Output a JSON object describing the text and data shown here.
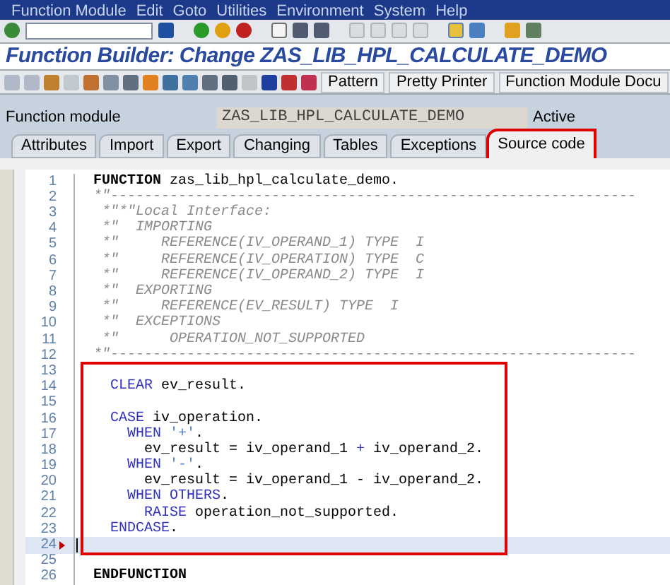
{
  "menu_bar": [
    "Function Module",
    "Edit",
    "Goto",
    "Utilities",
    "Environment",
    "System",
    "Help"
  ],
  "title": "Function Builder: Change ZAS_LIB_HPL_CALCULATE_DEMO",
  "app_toolbar": {
    "buttons": [
      "Pattern",
      "Pretty Printer",
      "Function Module Docu"
    ]
  },
  "header": {
    "label": "Function module",
    "value": "ZAS_LIB_HPL_CALCULATE_DEMO",
    "status": "Active"
  },
  "tabs": [
    {
      "label": "Attributes",
      "selected": false,
      "highlighted": false
    },
    {
      "label": "Import",
      "selected": false,
      "highlighted": false
    },
    {
      "label": "Export",
      "selected": false,
      "highlighted": false
    },
    {
      "label": "Changing",
      "selected": false,
      "highlighted": false
    },
    {
      "label": "Tables",
      "selected": false,
      "highlighted": false
    },
    {
      "label": "Exceptions",
      "selected": false,
      "highlighted": false
    },
    {
      "label": "Source code",
      "selected": true,
      "highlighted": true
    }
  ],
  "editor": {
    "lines_before": [
      {
        "number": "1",
        "current": false,
        "segments": [
          {
            "kind": "bold",
            "text": "FUNCTION"
          },
          {
            "kind": "plain",
            "text": " zas_lib_hpl_calculate_demo."
          }
        ]
      },
      {
        "number": "2",
        "current": false,
        "segments": [
          {
            "kind": "comment",
            "text": "*\"--------------------------------------------------------------"
          }
        ]
      },
      {
        "number": "3",
        "current": false,
        "segments": [
          {
            "kind": "comment",
            "text": " *\"*\"Local Interface:"
          }
        ]
      },
      {
        "number": "4",
        "current": false,
        "segments": [
          {
            "kind": "comment",
            "text": " *\"  IMPORTING"
          }
        ]
      },
      {
        "number": "5",
        "current": false,
        "segments": [
          {
            "kind": "comment",
            "text": " *\"     REFERENCE(IV_OPERAND_1) TYPE  I"
          }
        ]
      },
      {
        "number": "6",
        "current": false,
        "segments": [
          {
            "kind": "comment",
            "text": " *\"     REFERENCE(IV_OPERATION) TYPE  C"
          }
        ]
      },
      {
        "number": "7",
        "current": false,
        "segments": [
          {
            "kind": "comment",
            "text": " *\"     REFERENCE(IV_OPERAND_2) TYPE  I"
          }
        ]
      },
      {
        "number": "8",
        "current": false,
        "segments": [
          {
            "kind": "comment",
            "text": " *\"  EXPORTING"
          }
        ]
      },
      {
        "number": "9",
        "current": false,
        "segments": [
          {
            "kind": "comment",
            "text": " *\"     REFERENCE(EV_RESULT) TYPE  I"
          }
        ]
      },
      {
        "number": "10",
        "current": false,
        "segments": [
          {
            "kind": "comment",
            "text": " *\"  EXCEPTIONS"
          }
        ]
      },
      {
        "number": "11",
        "current": false,
        "segments": [
          {
            "kind": "comment",
            "text": " *\"      OPERATION_NOT_SUPPORTED"
          }
        ]
      },
      {
        "number": "12",
        "current": false,
        "segments": [
          {
            "kind": "comment",
            "text": "*\"--------------------------------------------------------------"
          }
        ]
      }
    ],
    "highlighted_lines": [
      {
        "number": "13",
        "current": false
      },
      {
        "number": "14",
        "current": false,
        "segments": [
          {
            "kind": "keyword",
            "text": "  CLEAR"
          },
          {
            "kind": "plain",
            "text": " ev_result."
          }
        ]
      },
      {
        "number": "15",
        "current": false
      },
      {
        "number": "16",
        "current": false,
        "segments": [
          {
            "kind": "keyword",
            "text": "  CASE"
          },
          {
            "kind": "plain",
            "text": " iv_operation."
          }
        ]
      },
      {
        "number": "17",
        "current": false,
        "segments": [
          {
            "kind": "keyword",
            "text": "    WHEN"
          },
          {
            "kind": "literal",
            "text": " '+'"
          },
          {
            "kind": "plain",
            "text": "."
          }
        ]
      },
      {
        "number": "18",
        "current": false,
        "segments": [
          {
            "kind": "plain",
            "text": "      ev_result = iv_operand_1 "
          },
          {
            "kind": "keyword",
            "text": "+"
          },
          {
            "kind": "plain",
            "text": " iv_operand_2."
          }
        ]
      },
      {
        "number": "19",
        "current": false,
        "segments": [
          {
            "kind": "keyword",
            "text": "    WHEN"
          },
          {
            "kind": "literal",
            "text": " '-'"
          },
          {
            "kind": "plain",
            "text": "."
          }
        ]
      },
      {
        "number": "20",
        "current": false,
        "segments": [
          {
            "kind": "plain",
            "text": "      ev_result = iv_operand_1 - iv_operand_2."
          }
        ]
      },
      {
        "number": "21",
        "current": false,
        "segments": [
          {
            "kind": "keyword",
            "text": "    WHEN OTHERS"
          },
          {
            "kind": "plain",
            "text": "."
          }
        ]
      },
      {
        "number": "22",
        "current": false,
        "segments": [
          {
            "kind": "keyword",
            "text": "      RAISE"
          },
          {
            "kind": "plain",
            "text": " operation_not_supported."
          }
        ]
      },
      {
        "number": "23",
        "current": false,
        "segments": [
          {
            "kind": "keyword",
            "text": "  ENDCASE"
          },
          {
            "kind": "plain",
            "text": "."
          }
        ]
      },
      {
        "number": "24",
        "current": true
      }
    ],
    "lines_after": [
      {
        "number": "25",
        "current": false
      },
      {
        "number": "26",
        "current": false,
        "segments": [
          {
            "kind": "bold",
            "text": "ENDFUNCTION"
          }
        ]
      }
    ]
  }
}
